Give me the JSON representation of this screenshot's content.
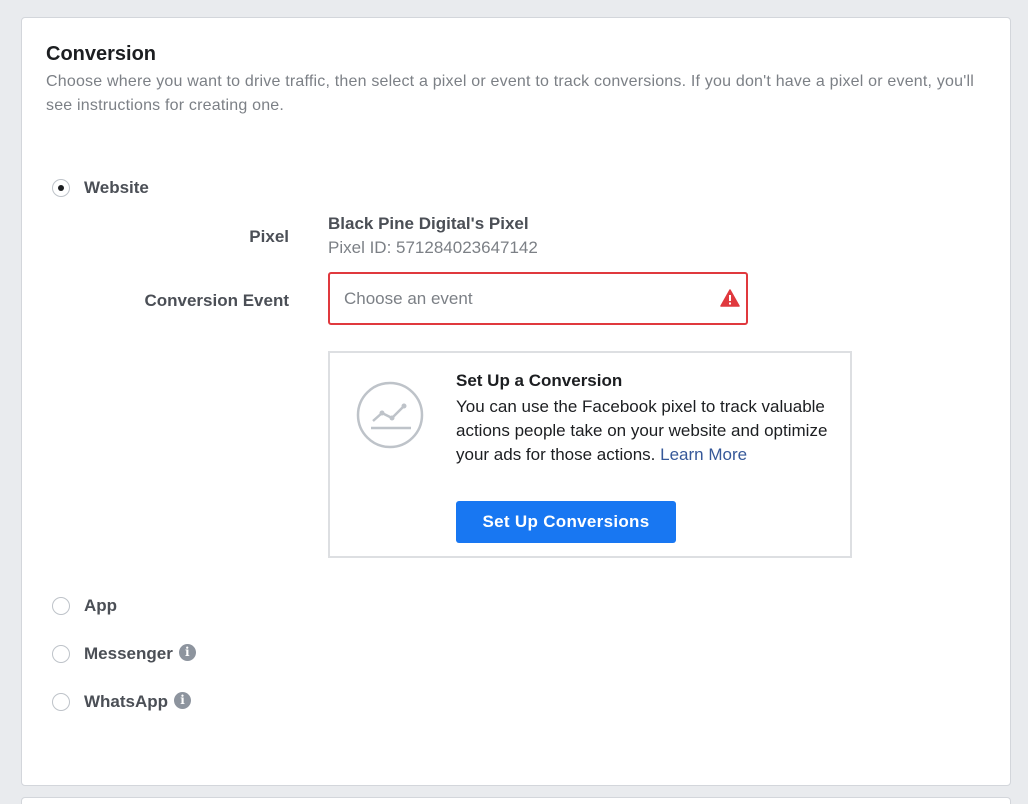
{
  "section": {
    "title": "Conversion",
    "description": "Choose where you want to drive traffic, then select a pixel or event to track conversions. If you don't have a pixel or event, you'll see instructions for creating one."
  },
  "options": {
    "website": {
      "label": "Website",
      "selected": true
    },
    "app": {
      "label": "App",
      "selected": false
    },
    "messenger": {
      "label": "Messenger",
      "selected": false
    },
    "whatsapp": {
      "label": "WhatsApp",
      "selected": false
    }
  },
  "pixel": {
    "label": "Pixel",
    "name": "Black Pine Digital's Pixel",
    "id_text": "Pixel ID: 571284023647142"
  },
  "conversion_event": {
    "label": "Conversion Event",
    "placeholder": "Choose an event",
    "value": "",
    "status_icon": "warning-icon"
  },
  "setup": {
    "icon": "line-chart-icon",
    "title": "Set Up a Conversion",
    "body": "You can use the Facebook pixel to track valuable actions people take on your website and optimize your ads for those actions.",
    "link": "Learn More",
    "button": "Set Up Conversions"
  },
  "colors": {
    "error": "#e0393e",
    "primary": "#1877f2",
    "link": "#365899"
  }
}
